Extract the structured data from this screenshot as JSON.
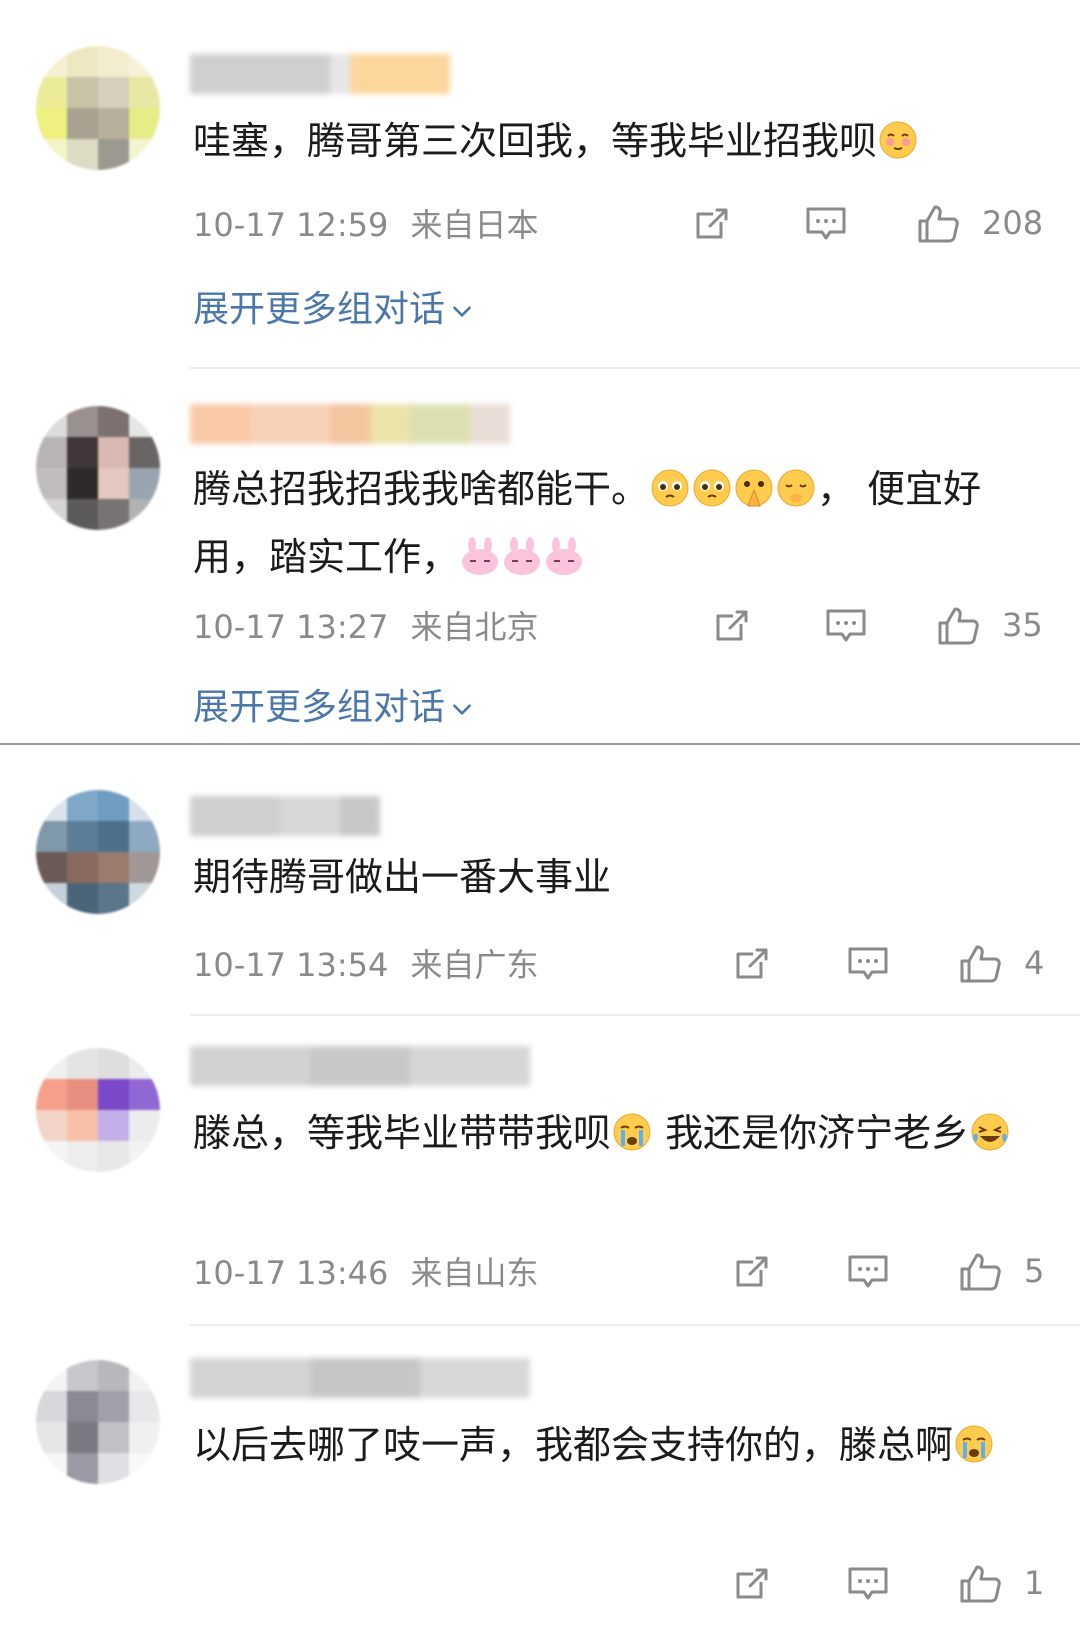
{
  "comments": [
    {
      "text": "哇塞，腾哥第三次回我，等我毕业招我呗",
      "emoji_after": [
        "shy-face-emoji"
      ],
      "time": "10-17 12:59",
      "location": "来自日本",
      "likes": "208",
      "expand": "展开更多组对话"
    },
    {
      "text_part1": "腾总招我招我我啥都能干。",
      "emoji_mid": [
        "pleading-emoji",
        "pleading-emoji",
        "praying-face-emoji",
        "hush-face-emoji"
      ],
      "text_part2": "， 便宜好用，踏实工作，",
      "emoji_after": [
        "pink-bunny-emoji",
        "pink-bunny-emoji",
        "pink-bunny-emoji"
      ],
      "time": "10-17 13:27",
      "location": "来自北京",
      "likes": "35",
      "expand": "展开更多组对话"
    },
    {
      "text": "期待腾哥做出一番大事业",
      "time": "10-17 13:54",
      "location": "来自广东",
      "likes": "4"
    },
    {
      "text_part1": "滕总，等我毕业带带我呗",
      "emoji_mid": [
        "crying-face-emoji"
      ],
      "text_part2": " 我还是你济宁老乡",
      "emoji_after": [
        "laugh-cry-emoji"
      ],
      "time": "10-17 13:46",
      "location": "来自山东",
      "likes": "5"
    },
    {
      "text": "以后去哪了吱一声，我都会支持你的，滕总啊",
      "emoji_after": [
        "crying-face-emoji"
      ],
      "likes": "1"
    }
  ],
  "icons": {
    "share": "share-icon",
    "comment": "comment-icon",
    "like": "like-icon",
    "expand": "chevron-down-icon"
  },
  "colors": {
    "link": "#4b78a8",
    "meta": "#8a8a8a",
    "text": "#1b1b1b"
  }
}
